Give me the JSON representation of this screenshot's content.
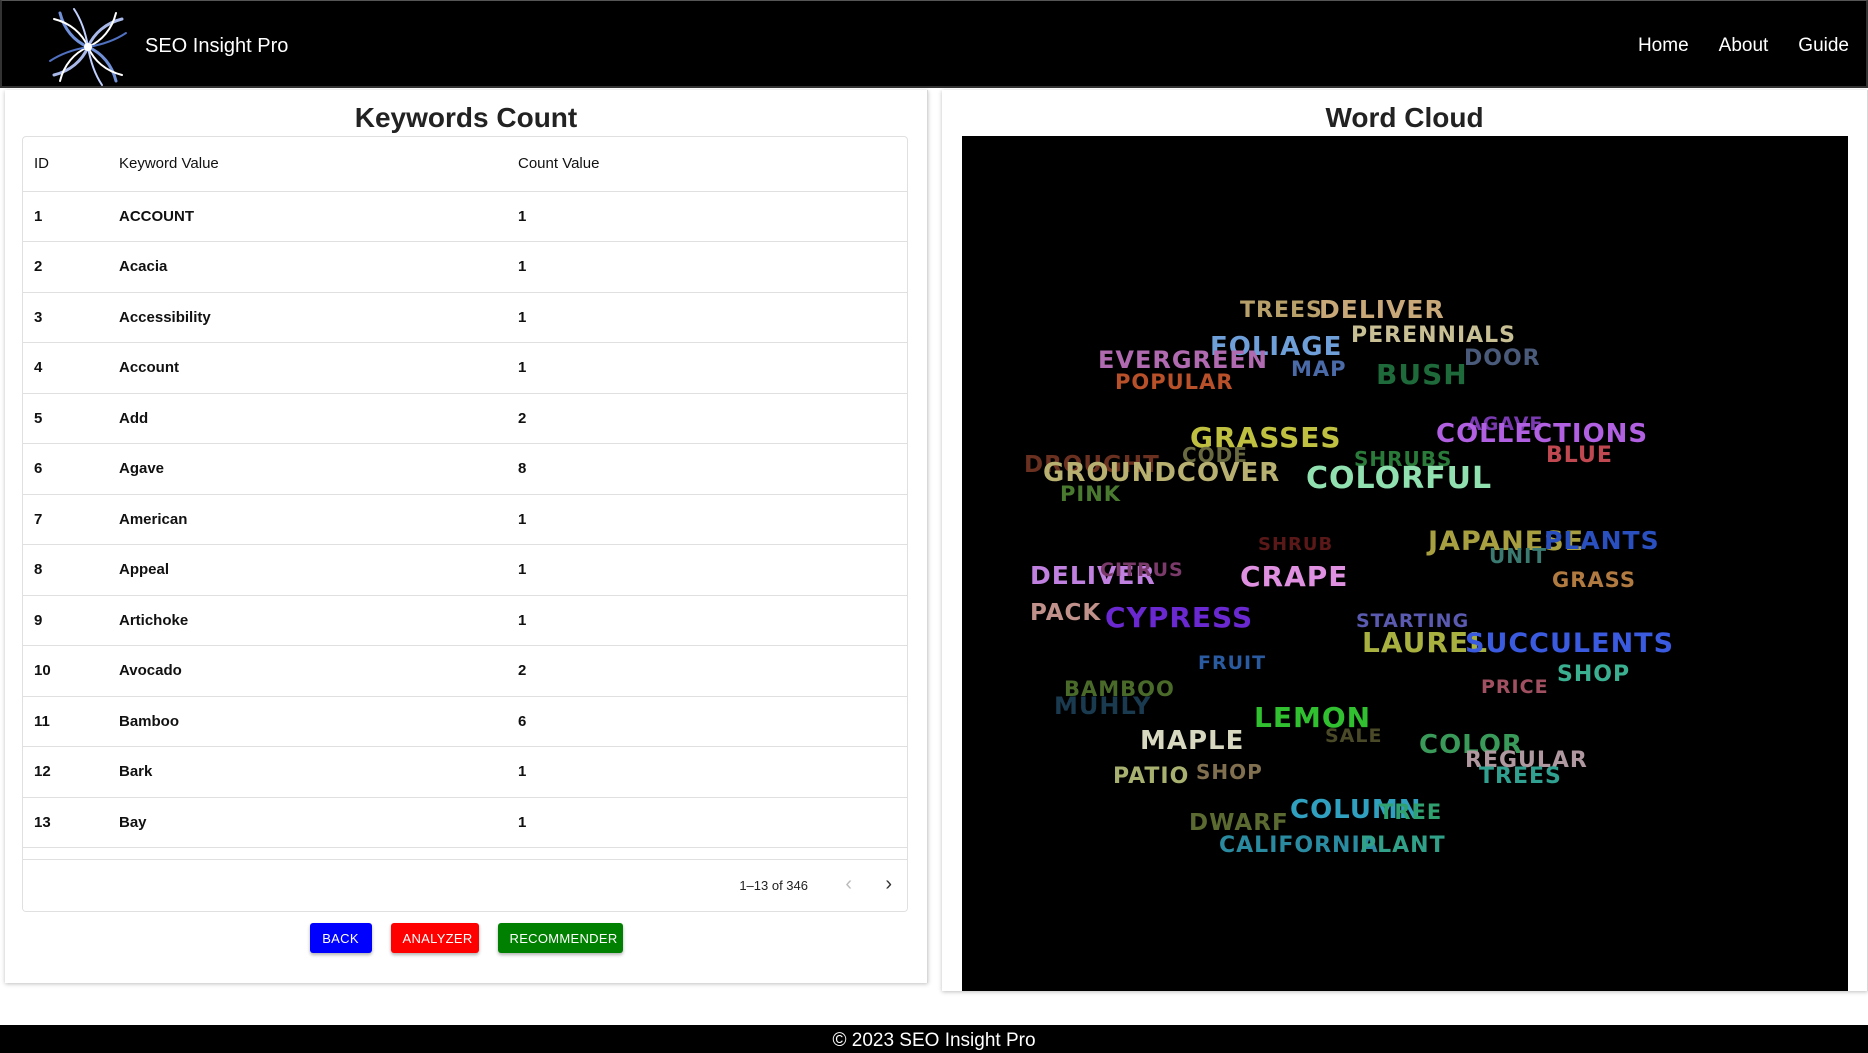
{
  "header": {
    "brand": "SEO Insight Pro",
    "nav": [
      "Home",
      "About",
      "Guide"
    ]
  },
  "keywords_panel": {
    "title": "Keywords Count",
    "columns": [
      "ID",
      "Keyword Value",
      "Count Value"
    ],
    "rows": [
      [
        "1",
        "ACCOUNT",
        "1"
      ],
      [
        "2",
        "Acacia",
        "1"
      ],
      [
        "3",
        "Accessibility",
        "1"
      ],
      [
        "4",
        "Account",
        "1"
      ],
      [
        "5",
        "Add",
        "2"
      ],
      [
        "6",
        "Agave",
        "8"
      ],
      [
        "7",
        "American",
        "1"
      ],
      [
        "8",
        "Appeal",
        "1"
      ],
      [
        "9",
        "Artichoke",
        "1"
      ],
      [
        "10",
        "Avocado",
        "2"
      ],
      [
        "11",
        "Bamboo",
        "6"
      ],
      [
        "12",
        "Bark",
        "1"
      ],
      [
        "13",
        "Bay",
        "1"
      ]
    ],
    "pagination": "1–13 of 346",
    "buttons": {
      "back": "BACK",
      "analyzer": "ANALYZER",
      "recommender": "RECOMMENDER"
    }
  },
  "wordcloud_panel": {
    "title": "Word Cloud",
    "words": [
      {
        "text": "TREES",
        "color": "#b8a06a"
      },
      {
        "text": "DELIVER",
        "color": "#c8a878"
      },
      {
        "text": "PERENNIALS",
        "color": "#c8c094"
      },
      {
        "text": "FOLIAGE",
        "color": "#6f9fd8"
      },
      {
        "text": "EVERGREEN",
        "color": "#b06ab0"
      },
      {
        "text": "MAP",
        "color": "#4a6aa8"
      },
      {
        "text": "BUSH",
        "color": "#1e6a3a"
      },
      {
        "text": "DOOR",
        "color": "#4a5a7a"
      },
      {
        "text": "POPULAR",
        "color": "#b8502a"
      },
      {
        "text": "AGAVE",
        "color": "#7a3ab0"
      },
      {
        "text": "GRASSES",
        "color": "#c0c040"
      },
      {
        "text": "COLLECTIONS",
        "color": "#b060e0"
      },
      {
        "text": "DROUGHT",
        "color": "#6a3020"
      },
      {
        "text": "CODE",
        "color": "#6a6a40"
      },
      {
        "text": "SHRUBS",
        "color": "#2a7a3a"
      },
      {
        "text": "BLUE",
        "color": "#c04850"
      },
      {
        "text": "GROUNDCOVER",
        "color": "#b8b070"
      },
      {
        "text": "COLORFUL",
        "color": "#90e0b0"
      },
      {
        "text": "PINK",
        "color": "#4a7a30"
      },
      {
        "text": "SHRUB",
        "color": "#5a1818"
      },
      {
        "text": "JAPANESE",
        "color": "#a8a040"
      },
      {
        "text": "PLANTS",
        "color": "#2a50c0"
      },
      {
        "text": "UNIT",
        "color": "#3a7a70"
      },
      {
        "text": "DELIVER",
        "color": "#c080e0"
      },
      {
        "text": "CITRUS",
        "color": "#7a3a6a"
      },
      {
        "text": "CRAPE",
        "color": "#e090e0"
      },
      {
        "text": "GRASS",
        "color": "#b07a40"
      },
      {
        "text": "PACK",
        "color": "#c0908a"
      },
      {
        "text": "CYPRESS",
        "color": "#6a28d0"
      },
      {
        "text": "STARTING",
        "color": "#5a5ab0"
      },
      {
        "text": "LAUREL",
        "color": "#a8b040"
      },
      {
        "text": "SUCCULENTS",
        "color": "#3a5ae0"
      },
      {
        "text": "FRUIT",
        "color": "#2a5aa0"
      },
      {
        "text": "SHOP",
        "color": "#3ab090"
      },
      {
        "text": "PRICE",
        "color": "#a05060"
      },
      {
        "text": "BAMBOO",
        "color": "#4a6a2a"
      },
      {
        "text": "MUHLY",
        "color": "#1a3a50"
      },
      {
        "text": "LEMON",
        "color": "#30c030"
      },
      {
        "text": "MAPLE",
        "color": "#d8d8c0"
      },
      {
        "text": "SALE",
        "color": "#4a4a28"
      },
      {
        "text": "COLOR",
        "color": "#3a9a5a"
      },
      {
        "text": "REGULAR",
        "color": "#b098a0"
      },
      {
        "text": "TREES",
        "color": "#30a090"
      },
      {
        "text": "PATIO",
        "color": "#a8b070"
      },
      {
        "text": "SHOP",
        "color": "#807050"
      },
      {
        "text": "COLUMN",
        "color": "#30a0c0"
      },
      {
        "text": "TREE",
        "color": "#30a070"
      },
      {
        "text": "DWARF",
        "color": "#5a6a30"
      },
      {
        "text": "CALIFORNIA",
        "color": "#2a8aa0"
      },
      {
        "text": "PLANT",
        "color": "#30a088"
      }
    ]
  },
  "footer": "© 2023 SEO Insight Pro"
}
